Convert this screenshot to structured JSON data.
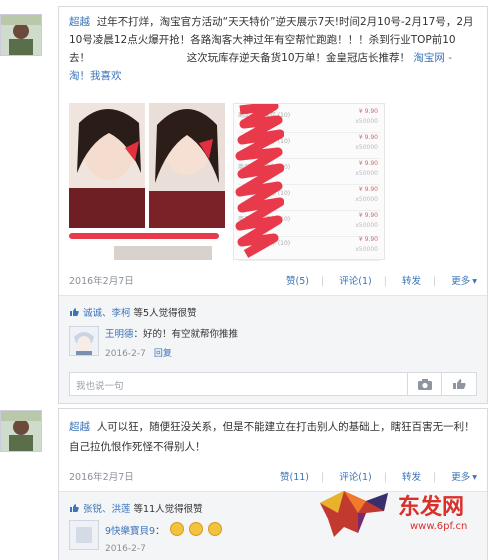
{
  "posts": [
    {
      "author": "超越",
      "text_part1": "过年不打烊，淘宝官方活动“天天特价”逆天展示7天!时间2月10号-2月17号，2月10号凌晨12点火爆开抢！各路淘客大神过年有空帮忙跑跑！！！杀到行业TOP前10去！",
      "text_part2": "这次玩库存逆天备货10万单！金皇冠店长推荐！",
      "link_text": "淘宝网 - 淘！我喜欢",
      "date": "2016年2月7日",
      "actions": {
        "like": "赞(5)",
        "comment": "评论(1)",
        "forward": "转发",
        "more": "更多"
      },
      "liked_by": "诚诚、李柯",
      "liked_suffix": "等5人觉得很赞",
      "order_rows": [
        {
          "title": "商品名称 库存 (10)",
          "price": "¥ 9.90",
          "sub": "x50000"
        },
        {
          "title": "商品名称 库存 (10)",
          "price": "¥ 9.90",
          "sub": "x50000"
        },
        {
          "title": "商品名称 库存 (10)",
          "price": "¥ 9.90",
          "sub": "x50000"
        },
        {
          "title": "商品名称 库存 (10)",
          "price": "¥ 9.90",
          "sub": "x50000"
        },
        {
          "title": "商品名称 库存 (10)",
          "price": "¥ 9.90",
          "sub": "x50000"
        },
        {
          "title": "商品名称 库存 (10)",
          "price": "¥ 9.90",
          "sub": "x50000"
        }
      ],
      "comment": {
        "name": "王明德",
        "text": "：好的！有空就帮你推推",
        "date": "2016-2-7",
        "reply": "回复"
      },
      "input_placeholder": "我也说一句"
    },
    {
      "author": "超越",
      "text": "人可以狂，随便狂没关系，但是不能建立在打击别人的基础上，瞎狂百害无一利！自己拉仇恨作死怪不得别人！",
      "date": "2016年2月7日",
      "actions": {
        "like": "赞(11)",
        "comment": "评论(1)",
        "forward": "转发",
        "more": "更多"
      },
      "liked_by": "张锐、洪莲",
      "liked_suffix": "等11人觉得很赞",
      "comment": {
        "name": "9快樂寶貝9",
        "text": "：",
        "date": "2016-2-7"
      }
    }
  ],
  "watermark": {
    "brand": "东发网",
    "url": "www.6pf.cn"
  },
  "colors": {
    "link": "#3b74b8",
    "border": "#d7dadf",
    "watermark": "#d8312c"
  }
}
